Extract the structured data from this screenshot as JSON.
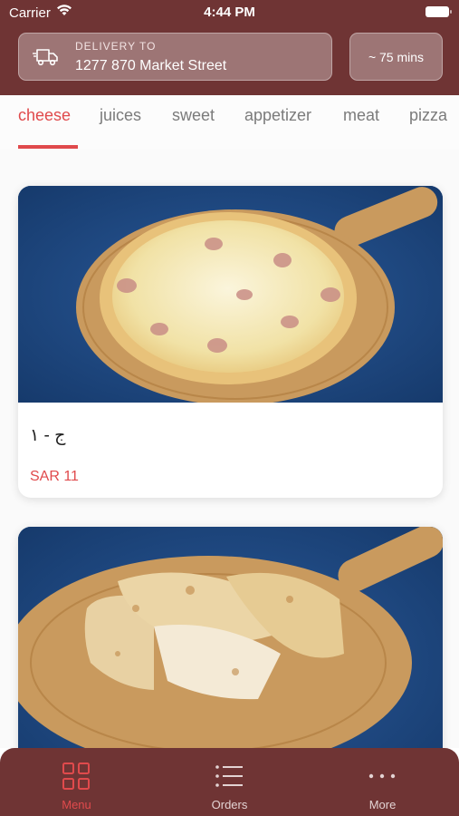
{
  "status_bar": {
    "carrier": "Carrier",
    "time": "4:44 PM"
  },
  "header": {
    "delivery_label": "DELIVERY TO",
    "delivery_address": "1277 870 Market Street",
    "eta": "~ 75 mins"
  },
  "tabs": [
    {
      "label": "cheese",
      "active": true
    },
    {
      "label": "juices"
    },
    {
      "label": "sweet"
    },
    {
      "label": "appetizer"
    },
    {
      "label": "meat"
    },
    {
      "label": "pizza"
    }
  ],
  "products": [
    {
      "name": "ج - ١",
      "price": "SAR 11",
      "image": "cheese-pizza-photo"
    },
    {
      "name": "",
      "price": "",
      "image": "cheese-fatayer-photo"
    }
  ],
  "bottom_nav": [
    {
      "label": "Menu",
      "icon": "grid-icon",
      "active": true
    },
    {
      "label": "Orders",
      "icon": "list-icon"
    },
    {
      "label": "More",
      "icon": "more-dots-icon"
    }
  ],
  "colors": {
    "brand": "#6f3434",
    "accent": "#e04a4c"
  }
}
